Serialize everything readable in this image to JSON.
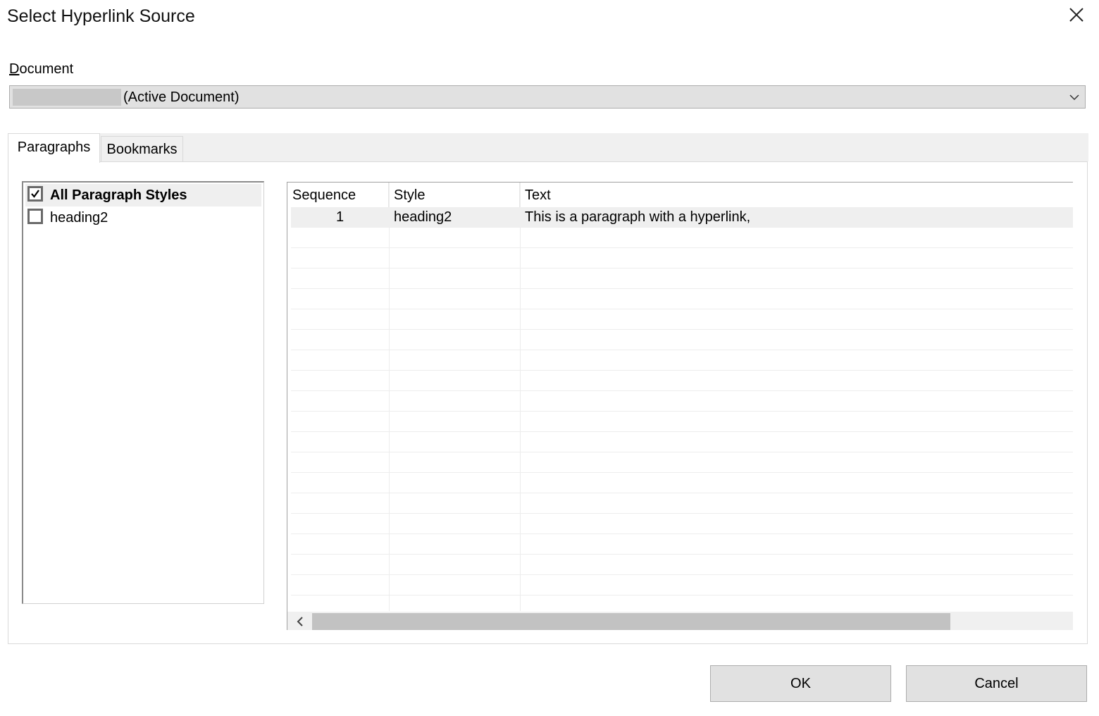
{
  "window": {
    "title": "Select Hyperlink Source"
  },
  "document": {
    "label_access_key": "D",
    "label_rest": "ocument",
    "selected_suffix": "(Active Document)"
  },
  "tabs": [
    {
      "label": "Paragraphs",
      "active": true
    },
    {
      "label": "Bookmarks",
      "active": false
    }
  ],
  "styles": [
    {
      "label": "All Paragraph Styles",
      "checked": true,
      "bold": true
    },
    {
      "label": "heading2",
      "checked": false,
      "bold": false
    }
  ],
  "table": {
    "columns": [
      "Sequence",
      "Style",
      "Text"
    ],
    "rows": [
      {
        "sequence": "1",
        "style": "heading2",
        "text": "This is a paragraph with a hyperlink,"
      }
    ]
  },
  "buttons": {
    "ok": "OK",
    "cancel": "Cancel"
  },
  "icons": {
    "close": "close-icon",
    "dropdown": "chevron-down-icon",
    "check": "checkmark-icon",
    "scroll_left": "chevron-left-icon"
  },
  "colors": {
    "button_bg": "#e1e1e1",
    "selection_bg": "#efefef",
    "scroll_thumb": "#c2c2c2"
  }
}
